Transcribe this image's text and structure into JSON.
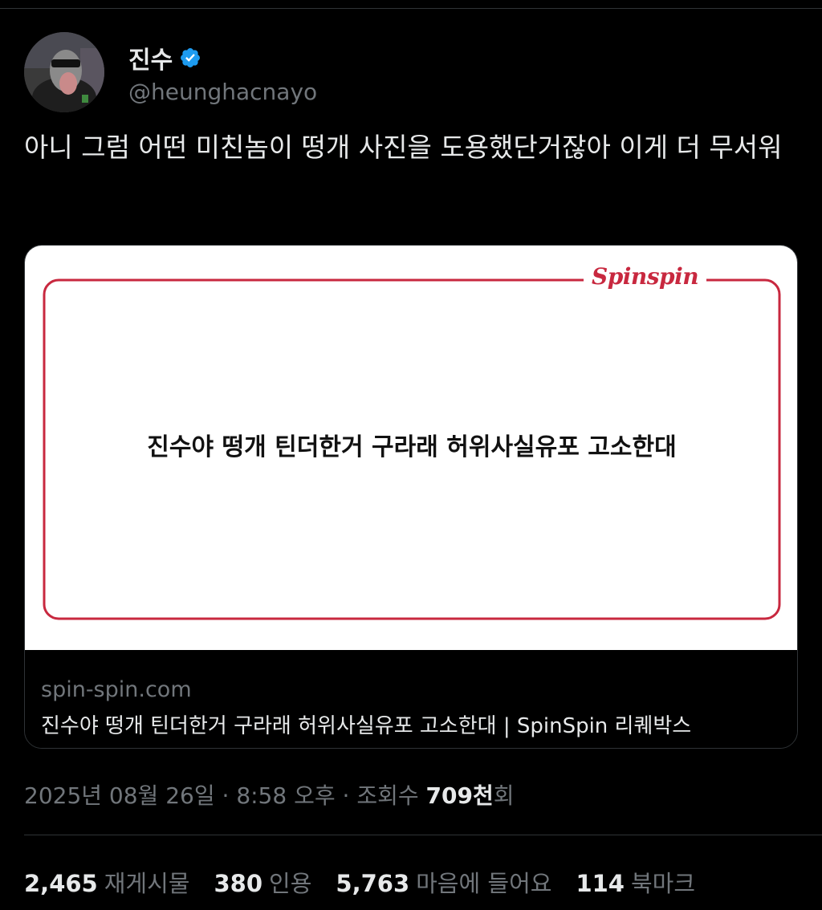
{
  "colors": {
    "background": "#000000",
    "text_primary": "#e7e9ea",
    "text_secondary": "#71767b",
    "verified_blue": "#1d9bf0",
    "card_accent_red": "#c8283f"
  },
  "author": {
    "display_name": "진수",
    "handle": "@heunghacnayo",
    "verified_icon": "verified-badge-icon"
  },
  "tweet": {
    "text": "아니 그럼 어떤 미친놈이 떵개 사진을 도용했단거잖아 이게 더 무서워"
  },
  "card": {
    "logo_text": "Spinspin",
    "headline": "진수야 떵개 틴더한거 구라래 허위사실유포 고소한대",
    "domain": "spin-spin.com",
    "title": "진수야 떵개 틴더한거 구라래 허위사실유포 고소한대 | SpinSpin 리퀘박스"
  },
  "meta": {
    "date": "2025년 08월 26일",
    "sep1": " · ",
    "time": "8:58 오후",
    "sep2": " · ",
    "views_label": "조회수 ",
    "views_count": "709천",
    "views_suffix": "회"
  },
  "stats": [
    {
      "num": "2,465",
      "label": "재게시물"
    },
    {
      "num": "380",
      "label": "인용"
    },
    {
      "num": "5,763",
      "label": "마음에 들어요"
    },
    {
      "num": "114",
      "label": "북마크"
    }
  ]
}
